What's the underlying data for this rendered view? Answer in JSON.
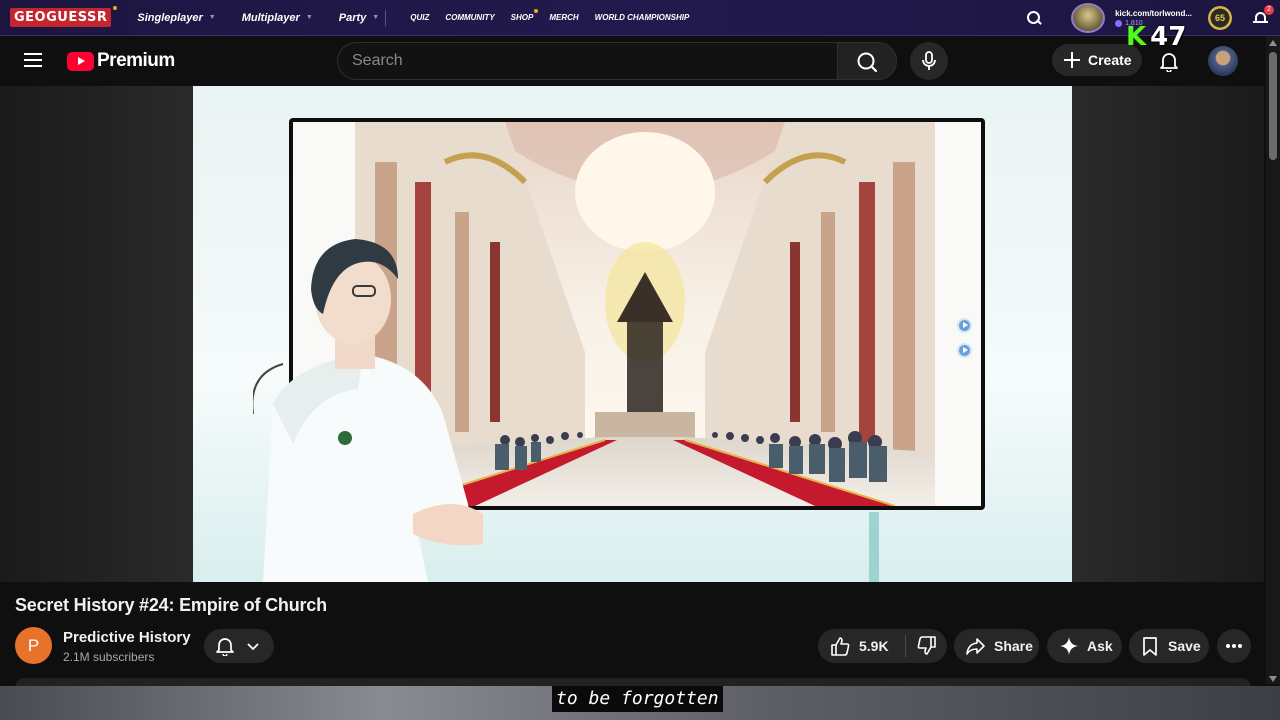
{
  "geoguessr": {
    "logo": "GEOGUESSR",
    "main_nav": [
      {
        "label": "Singleplayer"
      },
      {
        "label": "Multiplayer"
      },
      {
        "label": "Party"
      }
    ],
    "sub_nav": [
      {
        "label": "QUIZ"
      },
      {
        "label": "COMMUNITY"
      },
      {
        "label": "SHOP"
      },
      {
        "label": "MERCH"
      },
      {
        "label": "WORLD CHAMPIONSHIP"
      }
    ],
    "username": "kick.com/torlwond...",
    "points": "1,810",
    "level": "65",
    "notification_count": "2"
  },
  "overlay": {
    "kick_letter": "K",
    "kick_number": "47"
  },
  "youtube": {
    "logo_text": "Premium",
    "search_placeholder": "Search",
    "create_label": "Create"
  },
  "video": {
    "title": "Secret History #24: Empire of Church",
    "channel_initial": "P",
    "channel_name": "Predictive History",
    "subscribers": "2.1M subscribers",
    "likes": "5.9K",
    "share_label": "Share",
    "ask_label": "Ask",
    "save_label": "Save",
    "caption": "to be forgotten"
  },
  "colors": {
    "youtube_red": "#ff0033",
    "kick_green": "#53fc18",
    "geoguessr_bar": "#1d1540",
    "channel_avatar": "#e8712c"
  }
}
